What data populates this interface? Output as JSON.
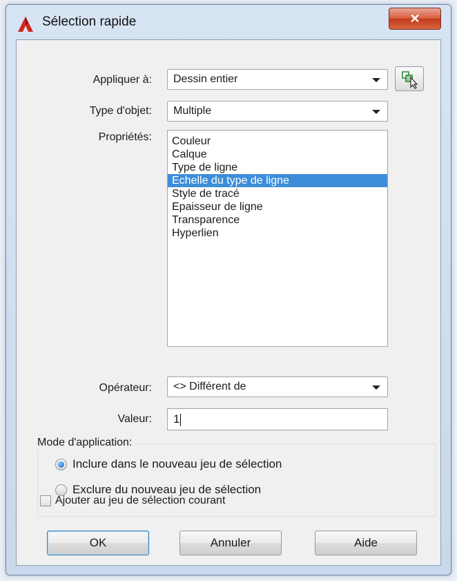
{
  "window": {
    "title": "Sélection rapide",
    "close_glyph": "✕"
  },
  "form": {
    "apply_label": "Appliquer à:",
    "apply_value": "Dessin entier",
    "object_type_label": "Type d'objet:",
    "object_type_value": "Multiple",
    "properties_label": "Propriétés:",
    "properties": [
      "Couleur",
      "Calque",
      "Type de ligne",
      "Echelle du type de ligne",
      "Style de tracé",
      "Epaisseur de ligne",
      "Transparence",
      "Hyperlien"
    ],
    "selected_property_index": 3,
    "operator_label": "Opérateur:",
    "operator_value": "<> Différent de",
    "value_label": "Valeur:",
    "value": "1"
  },
  "mode": {
    "title": "Mode d'application:",
    "include_label": "Inclure dans le nouveau jeu de sélection",
    "exclude_label": "Exclure du nouveau jeu de sélection",
    "selected": "include"
  },
  "append": {
    "label": "Ajouter au jeu de sélection courant",
    "checked": false
  },
  "buttons": {
    "ok": "OK",
    "cancel": "Annuler",
    "help": "Aide"
  },
  "icons": {
    "app": "autocad-logo-icon",
    "pick": "select-objects-icon",
    "close": "close-icon"
  },
  "colors": {
    "selection": "#3d8ed9",
    "close_button": "#c13a1b",
    "accent": "#3c7fb1"
  }
}
